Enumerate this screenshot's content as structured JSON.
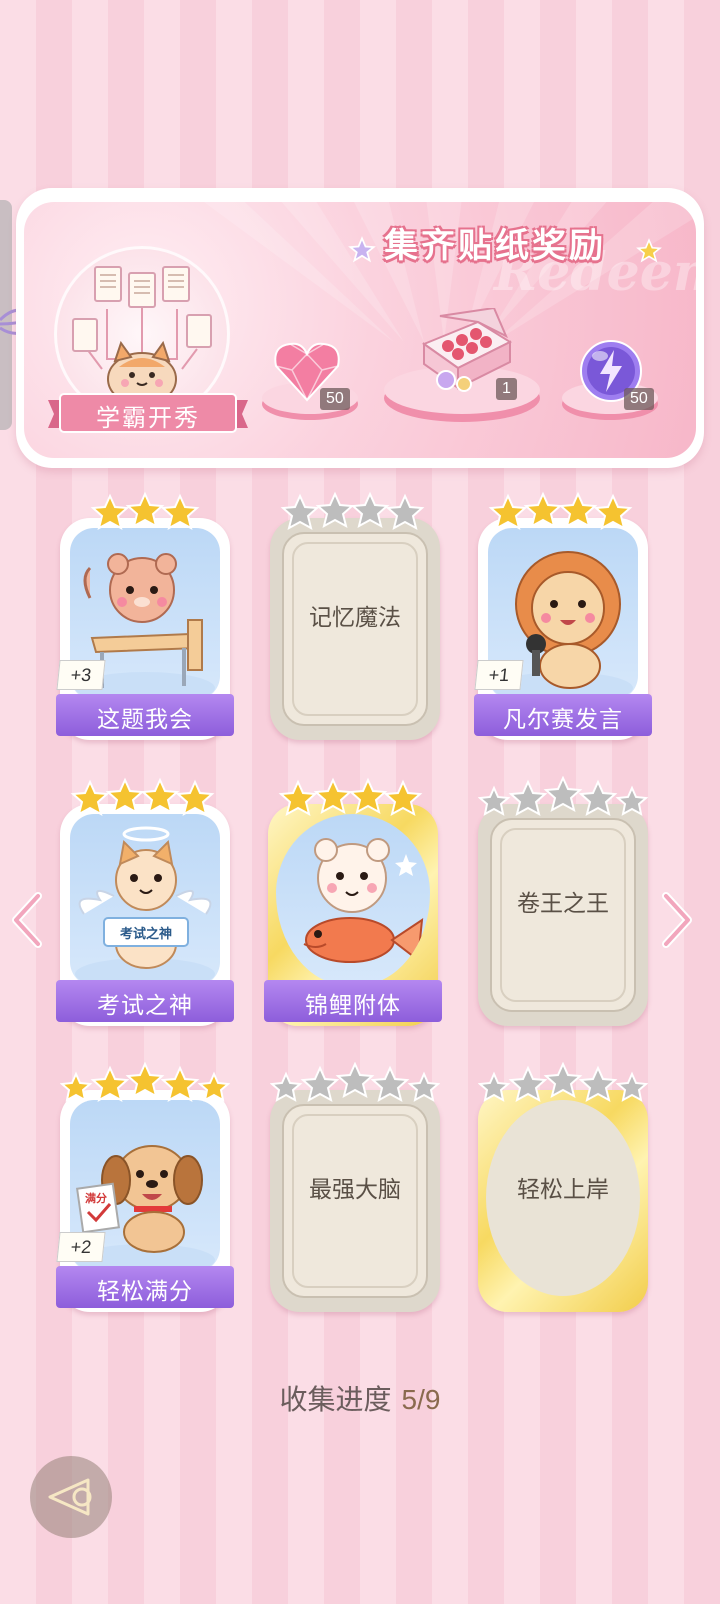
{
  "banner": {
    "title": "集齐贴纸奖励",
    "watermark": "Redeem",
    "ribbon_label": "学霸开秀",
    "rewards": [
      {
        "icon": "pink-heart-gem-icon",
        "count": "50"
      },
      {
        "icon": "gift-box-icon",
        "count": "1"
      },
      {
        "icon": "lightning-orb-icon",
        "count": "50"
      }
    ]
  },
  "cards": [
    {
      "name": "这题我会",
      "stars": 3,
      "unlocked": true,
      "plus": "+3",
      "art": "bear-at-desk"
    },
    {
      "name": "记忆魔法",
      "stars": 4,
      "unlocked": false
    },
    {
      "name": "凡尔赛发言",
      "stars": 4,
      "unlocked": true,
      "plus": "+1",
      "art": "lion-with-microphone"
    },
    {
      "name": "考试之神",
      "stars": 4,
      "unlocked": true,
      "art": "angel-cat",
      "sign": "考试之神"
    },
    {
      "name": "锦鲤附体",
      "stars": 4,
      "unlocked": true,
      "art": "bear-with-koi",
      "gold": true
    },
    {
      "name": "卷王之王",
      "stars": 5,
      "unlocked": false
    },
    {
      "name": "轻松满分",
      "stars": 5,
      "unlocked": true,
      "plus": "+2",
      "art": "puppy-with-test",
      "paper_label": "满分"
    },
    {
      "name": "最强大脑",
      "stars": 5,
      "unlocked": false
    },
    {
      "name": "轻松上岸",
      "stars": 5,
      "unlocked": false,
      "gold": true
    }
  ],
  "progress": {
    "label": "收集进度",
    "value": "5/9",
    "collected": 5,
    "total": 9
  },
  "colors": {
    "accent_purple": "#9a6be0",
    "star_gold": "#f5c330",
    "star_gray": "#b8b8b8",
    "banner_pink": "#f7b7c9"
  }
}
